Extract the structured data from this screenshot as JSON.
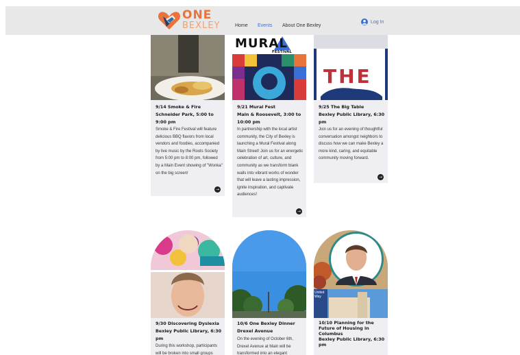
{
  "header": {
    "logo_one": "ONE",
    "logo_bexley": "BEXLEY",
    "nav": [
      {
        "label": "Home"
      },
      {
        "label": "Events"
      },
      {
        "label": "About One Bexley"
      }
    ],
    "login_label": "Log In"
  },
  "colors": {
    "accent": "#3a6fd8",
    "brand_orange": "#e8743b",
    "card_bg": "#efeef2"
  },
  "events": [
    {
      "title": "9/14 Smoke & Fire",
      "subtitle": "Schneider Park, 5:00 to 9:00 pm",
      "description": "Smoke & Fire Festival will feature delicious BBQ flavors from local vendors and foodies, accompanied by live music by the Roots Society from 5:00 pm to 8:00 pm, followed by a Main Event showing of \"Wonka\" on the big screen!"
    },
    {
      "title": "9/21 Mural Fest",
      "subtitle": "Main & Roosevelt, 3:00 to 10:00 pm",
      "description": "In partnership with the local artist community, the City of Bexley is launching a Mural Festival along Main Street! Join us for an energetic celebration of art, culture, and community as we transform blank walls into vibrant works of wonder that will leave a lasting impression, ignite inspiration, and captivate audiences!",
      "image_text": "MURAL",
      "image_subtext": "FESTIVAL"
    },
    {
      "title": "9/25 The Big Table",
      "subtitle": "Bexley Public Library, 6:30 pm",
      "description": "Join us for an evening of thoughtful conversation amongst neighbors to discuss how we can make Bexley a more kind, caring, and equitable community moving forward.",
      "image_text": "THE"
    },
    {
      "title": "9/30 Discovering Dyslexia",
      "subtitle": "Bexley Public Library, 6:30 pm",
      "description": "During this workshop, participants will be broken into small groups"
    },
    {
      "title": "10/6 One Bexley Dinner",
      "subtitle": "Drexel Avenue",
      "description": "On the evening of October 6th, Drexel Avenue at Main will be transformed into an elegant"
    },
    {
      "title": "10/10 Planning for the Future of Housing in Columbus",
      "subtitle": "Bexley Public Library, 6:30 pm",
      "description": "",
      "image_text": "United Way"
    }
  ]
}
